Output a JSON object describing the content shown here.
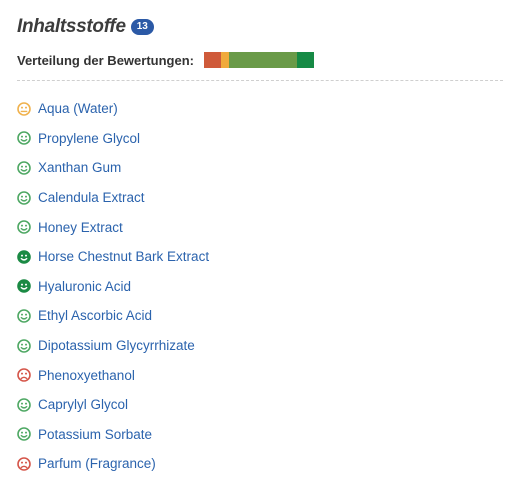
{
  "header": {
    "title": "Inhaltsstoffe",
    "count": "13"
  },
  "distribution": {
    "label": "Verteilung der Bewertungen:",
    "segments": [
      {
        "rating": "bad",
        "color": "#cf5a3a",
        "fraction": 0.154
      },
      {
        "rating": "medium",
        "color": "#f0aa3c",
        "fraction": 0.077
      },
      {
        "rating": "good",
        "color": "#6a9a48",
        "fraction": 0.615
      },
      {
        "rating": "very-good",
        "color": "#168a45",
        "fraction": 0.154
      }
    ]
  },
  "ratingColors": {
    "bad": "#d5564a",
    "medium": "#f0b24e",
    "good": "#4fa864",
    "very-good": "#1b8a44"
  },
  "ingredients": [
    {
      "name": "Aqua (Water)",
      "rating": "medium"
    },
    {
      "name": "Propylene Glycol",
      "rating": "good"
    },
    {
      "name": "Xanthan Gum",
      "rating": "good"
    },
    {
      "name": "Calendula Extract",
      "rating": "good"
    },
    {
      "name": "Honey Extract",
      "rating": "good"
    },
    {
      "name": "Horse Chestnut Bark Extract",
      "rating": "very-good"
    },
    {
      "name": "Hyaluronic Acid",
      "rating": "very-good"
    },
    {
      "name": "Ethyl Ascorbic Acid",
      "rating": "good"
    },
    {
      "name": "Dipotassium Glycyrrhizate",
      "rating": "good"
    },
    {
      "name": "Phenoxyethanol",
      "rating": "bad"
    },
    {
      "name": "Caprylyl Glycol",
      "rating": "good"
    },
    {
      "name": "Potassium Sorbate",
      "rating": "good"
    },
    {
      "name": "Parfum (Fragrance)",
      "rating": "bad"
    }
  ]
}
